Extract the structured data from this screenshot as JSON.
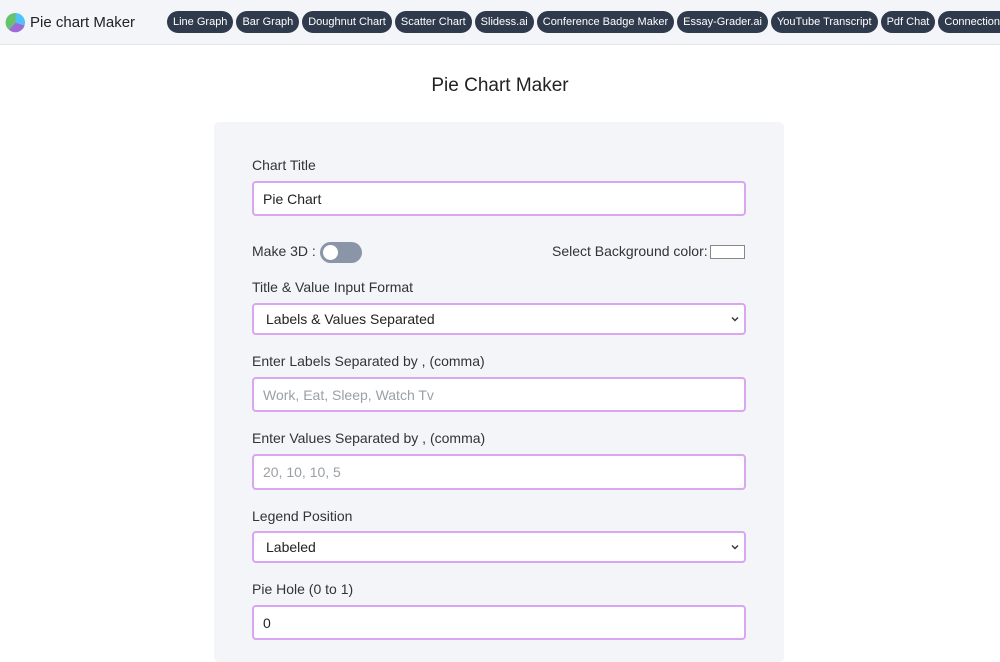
{
  "header": {
    "brand": "Pie chart Maker",
    "nav": [
      "Line Graph",
      "Bar Graph",
      "Doughnut Chart",
      "Scatter Chart",
      "Slidess.ai",
      "Conference Badge Maker",
      "Essay-Grader.ai",
      "YouTube Transcript",
      "Pdf Chat",
      "ConnectionsHint.ai"
    ]
  },
  "page": {
    "title": "Pie Chart Maker"
  },
  "form": {
    "chart_title": {
      "label": "Chart Title",
      "value": "Pie Chart"
    },
    "make3d": {
      "label": "Make 3D :",
      "enabled": false
    },
    "background": {
      "label": "Select Background color:",
      "color": "#ffffff"
    },
    "input_format": {
      "label": "Title & Value Input Format",
      "selected": "Labels & Values Separated"
    },
    "labels": {
      "label": "Enter Labels Separated by , (comma)",
      "placeholder": "Work, Eat, Sleep, Watch Tv"
    },
    "values": {
      "label": "Enter Values Separated by , (comma)",
      "placeholder": "20, 10, 10, 5"
    },
    "legend": {
      "label": "Legend Position",
      "selected": "Labeled"
    },
    "pie_hole": {
      "label": "Pie Hole (0 to 1)",
      "value": "0"
    }
  },
  "colors": {
    "nav_pill": "#2f3b4c",
    "field_border": "#d9a6f2",
    "card_bg": "#f3f5f9"
  }
}
